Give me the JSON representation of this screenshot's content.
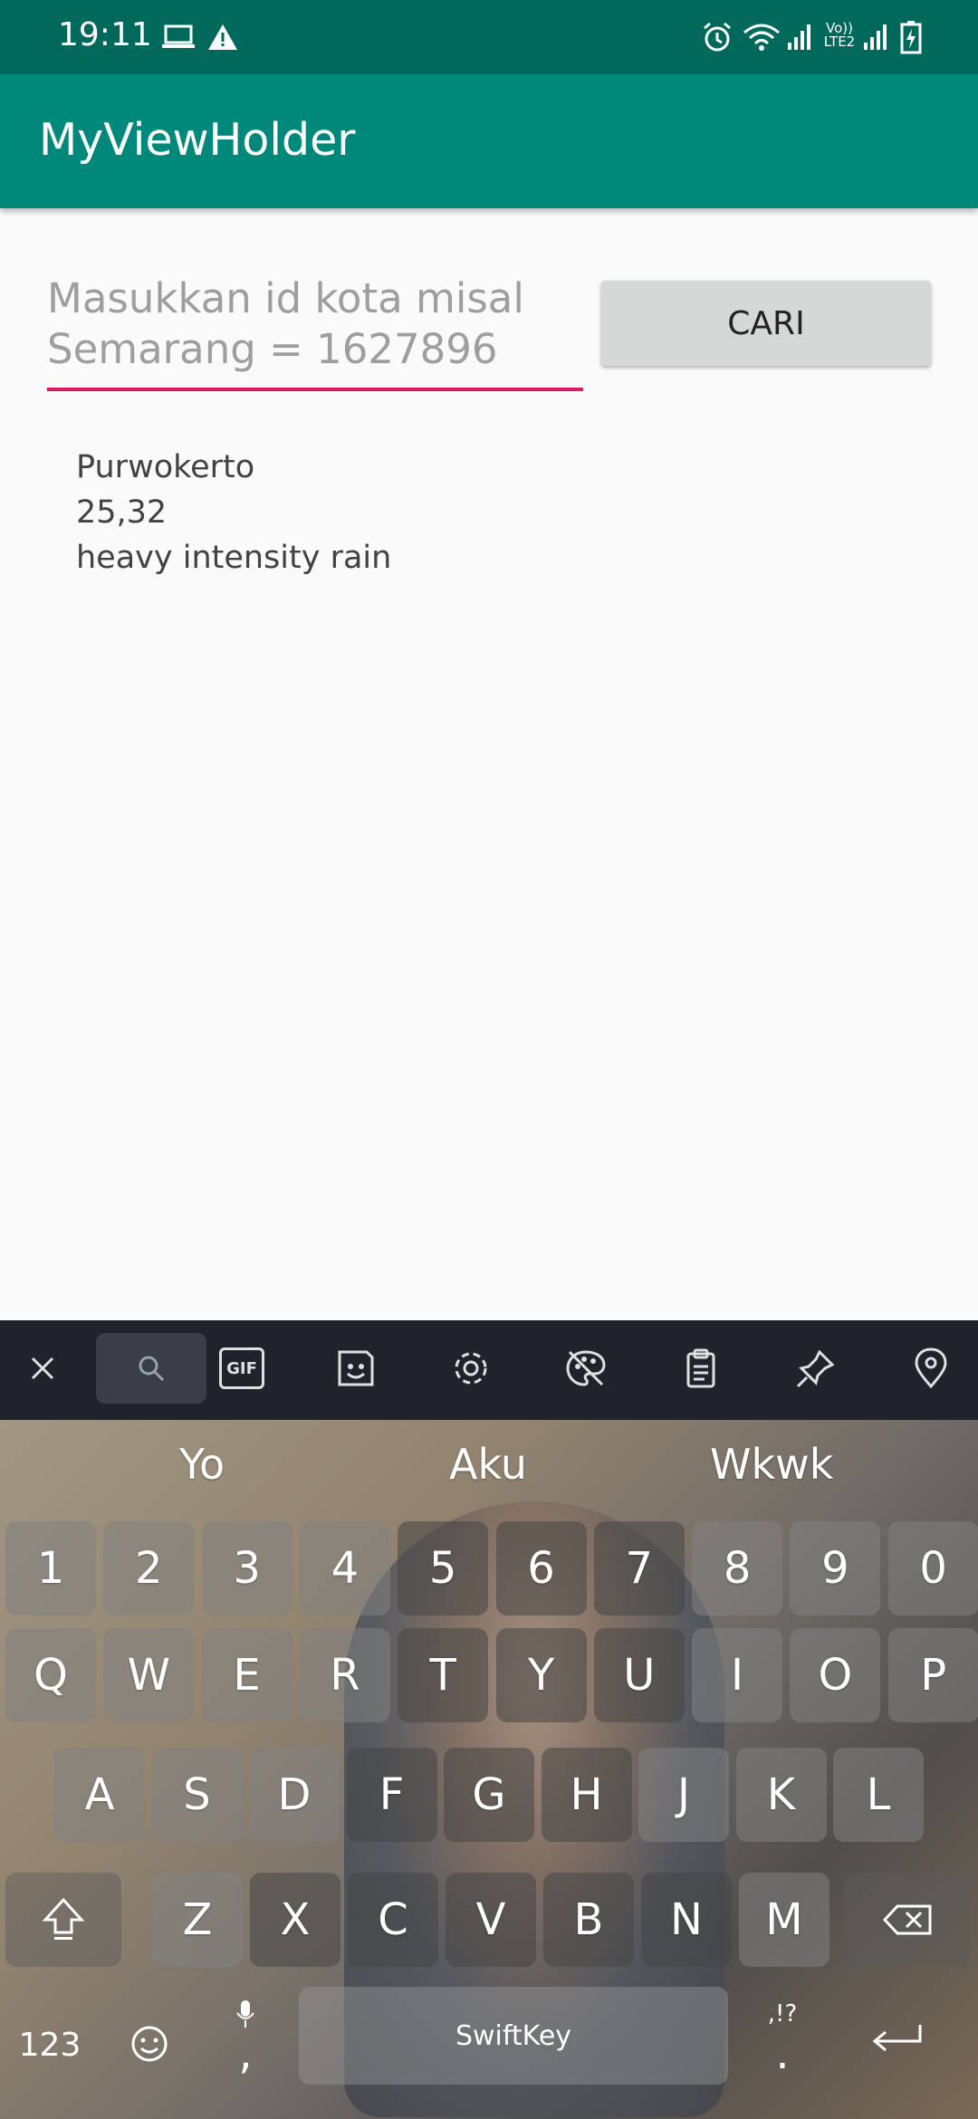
{
  "status_bar": {
    "time": "19:11",
    "icons": [
      "laptop-icon",
      "warning-icon",
      "alarm-icon",
      "wifi-icon",
      "signal-icon",
      "volte-icon",
      "signal-icon",
      "battery-charging-icon"
    ],
    "volte_label": "Vo)) LTE2"
  },
  "app_bar": {
    "title": "MyViewHolder"
  },
  "form": {
    "input_placeholder": "Masukkan id kota misal Semarang = 1627896",
    "button_label": "CARI"
  },
  "result": {
    "city": "Purwokerto",
    "temperature": "25,32",
    "description": "heavy intensity rain"
  },
  "keyboard": {
    "toolbar": [
      "close-icon",
      "search-icon",
      "gif-icon",
      "sticker-icon",
      "settings-icon",
      "theme-icon",
      "clipboard-icon",
      "pin-icon",
      "location-icon"
    ],
    "gif_label": "GIF",
    "suggestions": [
      "Yo",
      "Aku",
      "Wkwk"
    ],
    "rows": [
      [
        "1",
        "2",
        "3",
        "4",
        "5",
        "6",
        "7",
        "8",
        "9",
        "0"
      ],
      [
        "Q",
        "W",
        "E",
        "R",
        "T",
        "Y",
        "U",
        "I",
        "O",
        "P"
      ],
      [
        "A",
        "S",
        "D",
        "F",
        "G",
        "H",
        "J",
        "K",
        "L"
      ],
      [
        "Z",
        "X",
        "C",
        "V",
        "B",
        "N",
        "M"
      ]
    ],
    "numbers_label": "123",
    "comma_label": ",",
    "punct_label": ",!?",
    "period_label": ".",
    "space_label": "SwiftKey"
  }
}
